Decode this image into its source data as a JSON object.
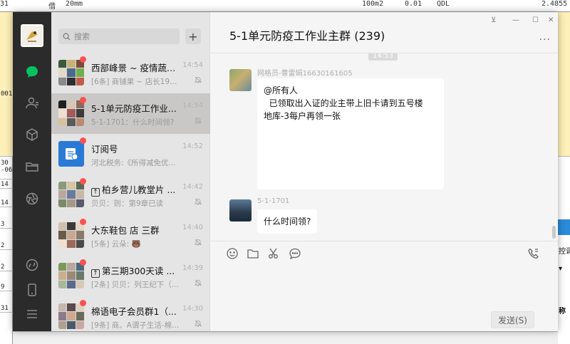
{
  "background": {
    "top_row": [
      "31",
      "借",
      "20mm",
      "100m2",
      "0.01",
      "QDL",
      "2.4855"
    ],
    "side_number": "001(",
    "left_cells": [
      "30\n-063",
      "14",
      "14",
      "3",
      "2",
      "2",
      "9",
      "31"
    ],
    "right_cells": [
      "控调",
      "▾",
      "称"
    ]
  },
  "nav": {
    "items": [
      {
        "name": "chat",
        "icon": "chat-bubble-icon"
      },
      {
        "name": "contacts",
        "icon": "contacts-icon"
      },
      {
        "name": "favorites",
        "icon": "cube-icon"
      },
      {
        "name": "files",
        "icon": "folder-icon"
      },
      {
        "name": "moments",
        "icon": "aperture-icon"
      },
      {
        "name": "mini-programs",
        "icon": "link-icon"
      },
      {
        "name": "phone",
        "icon": "phone-device-icon"
      },
      {
        "name": "settings",
        "icon": "menu-icon"
      }
    ],
    "accent": "#07c160"
  },
  "search": {
    "placeholder": "搜索",
    "add": "+"
  },
  "chats": [
    {
      "name": "西部峰景 ~ 疫情蔬菜...",
      "time": "14:54",
      "preview": "[6条] 商铺果 ~ 店长1993...",
      "unread": true,
      "muted": true,
      "pinned": false
    },
    {
      "name": "5-1单元防疫工作业...",
      "time": "14:54",
      "preview": "5-1-1701：什么时间领?",
      "unread": true,
      "muted": true,
      "pinned": false,
      "active": true
    },
    {
      "name": "订阅号",
      "time": "14:52",
      "preview": "河北税务:《所得减免优...",
      "unread": true,
      "muted": false,
      "pinned": false
    },
    {
      "name": "柏乡营儿教堂片 ...",
      "time": "14:42",
      "preview": "贝贝：则：第9章已读",
      "unread": true,
      "muted": true,
      "pinned": true
    },
    {
      "name": "大东鞋包 店 三群",
      "time": "14:40",
      "preview": "[5条] 云朵: 🐻",
      "unread": true,
      "muted": true,
      "pinned": false
    },
    {
      "name": "第三期300天读 ...",
      "time": "14:39",
      "preview": "[2条] 贝贝：列王纪下（...",
      "unread": true,
      "muted": true,
      "pinned": true
    },
    {
      "name": "棉语电子会员群1（...",
      "time": "14:30",
      "preview": "[9条] 商。A谓子生活-棉...",
      "unread": true,
      "muted": true,
      "pinned": false
    }
  ],
  "conversation": {
    "title": "5-1单元防疫工作业主群 (239)",
    "window_controls": [
      "⊻",
      "—",
      "☐",
      "✕"
    ],
    "more": "···",
    "timestamp": "14:53",
    "messages": [
      {
        "sender": "网格员-曹雷娟16630161605",
        "lines": [
          "@所有人",
          "  已领取出入证的业主带上旧卡请到五号楼",
          "地库-3每户再领一张"
        ]
      },
      {
        "sender": "5-1-1701",
        "lines": [
          "什么时间领?"
        ]
      }
    ]
  },
  "composer": {
    "tools": [
      "emoji-icon",
      "folder-icon",
      "scissors-icon",
      "chat-history-icon",
      "voice-call-icon"
    ],
    "send_label": "发送(S)"
  }
}
